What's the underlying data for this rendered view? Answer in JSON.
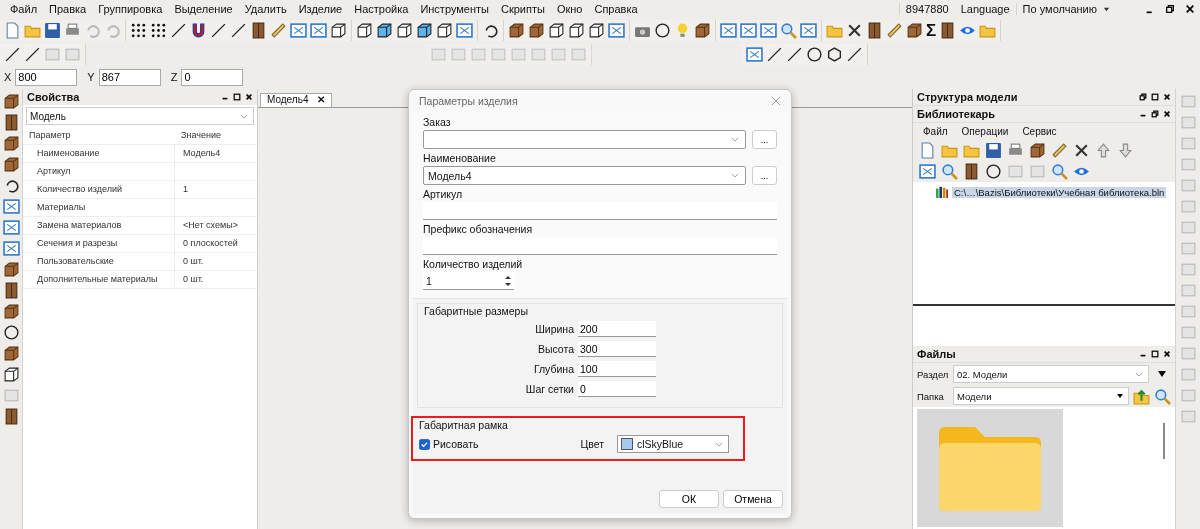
{
  "menu": [
    "Файл",
    "Правка",
    "Группировка",
    "Выделение",
    "Удалить",
    "Изделие",
    "Настройка",
    "Инструменты",
    "Скрипты",
    "Окно",
    "Справка"
  ],
  "top_right": {
    "account": "8947880",
    "language": "Language",
    "profile": "По умолчанию"
  },
  "toolbar_glyph": "Σ",
  "coords": [
    {
      "label": "X",
      "value": "800"
    },
    {
      "label": "Y",
      "value": "867"
    },
    {
      "label": "Z",
      "value": "0"
    }
  ],
  "properties_panel": {
    "title": "Свойства",
    "selector": "Модель",
    "columns": [
      "Параметр",
      "Значение"
    ],
    "rows": [
      {
        "name": "Наименование",
        "value": "Модель4"
      },
      {
        "name": "Артикул"
      },
      {
        "name": "Количество изделий",
        "value": "1"
      },
      {
        "name": "Материалы"
      },
      {
        "name": "Замена материалов",
        "value": "<Нет схемы>"
      },
      {
        "name": "Сечения и разрезы",
        "value": "0 плоскостей"
      },
      {
        "name": "Пользовательские",
        "value": "0 шт."
      },
      {
        "name": "Дополнительные материалы",
        "value": "0 шт."
      }
    ]
  },
  "document_tabs": [
    {
      "label": "Модель4",
      "selected": true,
      "close": "✕"
    }
  ],
  "dialog": {
    "title": "Параметры изделия",
    "fields": [
      {
        "kind": "combo",
        "label": "Заказ",
        "browse": "..."
      },
      {
        "kind": "combo",
        "label": "Наименование",
        "value": "Модель4",
        "browse": "..."
      },
      {
        "kind": "text",
        "label": "Артикул"
      },
      {
        "kind": "text",
        "label": "Префикс обозначения"
      },
      {
        "kind": "spin",
        "label": "Количество изделий",
        "value": "1"
      }
    ],
    "dimensions": {
      "title": "Габаритные размеры",
      "rows": [
        {
          "label": "Ширина",
          "value": "200"
        },
        {
          "label": "Высота",
          "value": "300"
        },
        {
          "label": "Глубина",
          "value": "100"
        },
        {
          "label": "Шаг сетки",
          "value": "0"
        }
      ]
    },
    "frame": {
      "title": "Габаритная рамка",
      "highlighted": true,
      "draw_label": "Рисовать",
      "checked": true,
      "color_label": "Цвет",
      "color_value": "clSkyBlue"
    },
    "buttons": [
      "ОК",
      "Отмена"
    ]
  },
  "structure_panel": {
    "title": "Структура модели"
  },
  "librarian": {
    "title": "Библиотекарь",
    "menu": [
      "Файл",
      "Операции",
      "Сервис"
    ],
    "tree": [
      {
        "label": "C:\\…\\Bazis\\Библиотеки\\Учебная библиотека.bln",
        "selected": true
      }
    ]
  },
  "files_panel": {
    "title": "Файлы",
    "section_label": "Раздел",
    "section": "02. Модели",
    "folder_label": "Папка",
    "folder": "Модели"
  }
}
